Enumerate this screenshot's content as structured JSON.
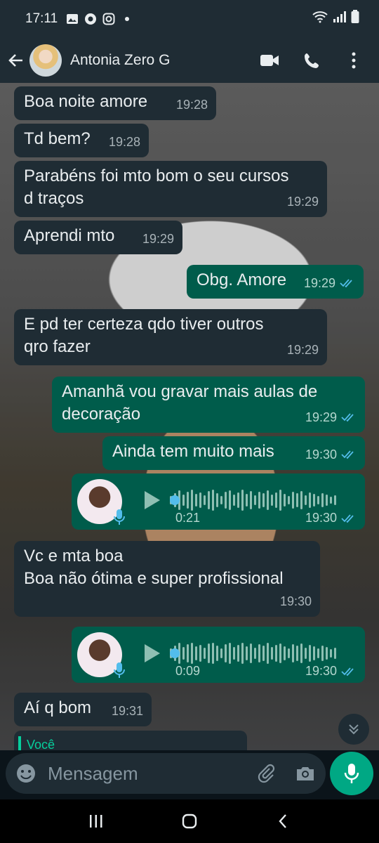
{
  "status": {
    "time": "17:11",
    "icons": [
      "image-icon",
      "chrome-icon",
      "instagram-icon",
      "dot-icon"
    ],
    "right_icons": [
      "wifi-icon",
      "signal-icon",
      "battery-icon"
    ]
  },
  "header": {
    "contact_name": "Antonia Zero G",
    "actions": [
      "video-call-icon",
      "voice-call-icon",
      "more-icon"
    ]
  },
  "messages": [
    {
      "dir": "in",
      "lines": [
        "Boa noite amore"
      ],
      "time": "19:28"
    },
    {
      "dir": "in",
      "lines": [
        "Td bem?"
      ],
      "time": "19:28"
    },
    {
      "dir": "in",
      "lines": [
        "Parabéns foi mto bom o seu cursos",
        "d traços"
      ],
      "time": "19:29"
    },
    {
      "dir": "in",
      "lines": [
        "Aprendi mto"
      ],
      "time": "19:29"
    },
    {
      "dir": "out",
      "lines": [
        "Obg. Amore"
      ],
      "time": "19:29",
      "read": true
    },
    {
      "dir": "in",
      "lines": [
        "E pd ter certeza qdo tiver outros",
        "qro fazer"
      ],
      "time": "19:29"
    },
    {
      "dir": "out",
      "lines": [
        "Amanhã vou gravar mais aulas de",
        "decoração"
      ],
      "time": "19:29",
      "read": true
    },
    {
      "dir": "out",
      "lines": [
        "Ainda tem muito mais"
      ],
      "time": "19:30",
      "read": true
    },
    {
      "dir": "out",
      "type": "voice",
      "duration": "0:21",
      "time": "19:30",
      "read": true
    },
    {
      "dir": "in",
      "lines": [
        "Vc e mta boa",
        "Boa não ótima e super profissional"
      ],
      "time": "19:30"
    },
    {
      "dir": "out",
      "type": "voice",
      "duration": "0:09",
      "time": "19:30",
      "read": true
    },
    {
      "dir": "in",
      "lines": [
        "Aí q bom"
      ],
      "time": "19:31"
    }
  ],
  "partial_reply_label": "Você",
  "composer": {
    "placeholder": "Mensagem"
  },
  "colors": {
    "incoming": "#1f2c34",
    "outgoing": "#005c4b",
    "accent": "#00a884",
    "read_tick": "#53bdeb"
  }
}
